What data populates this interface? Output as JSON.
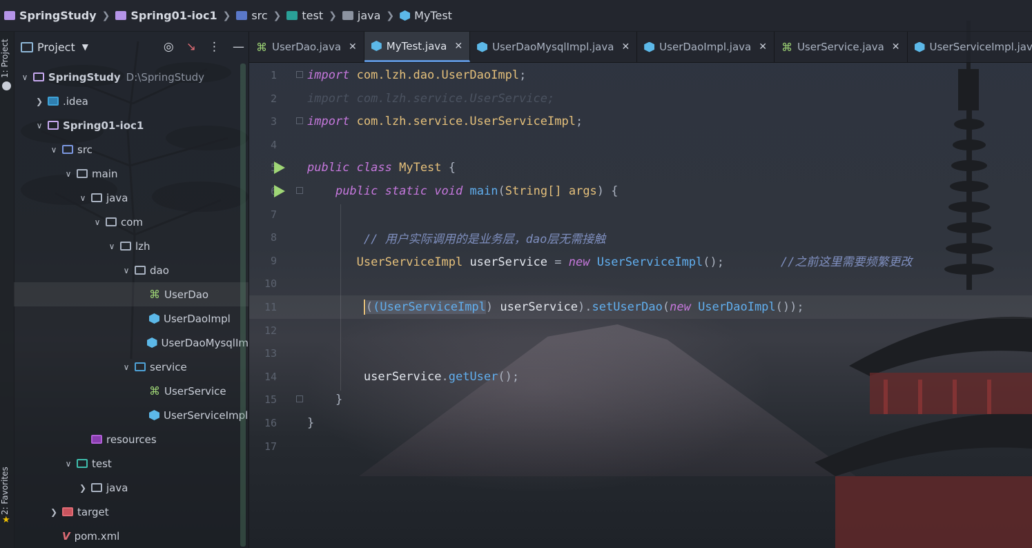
{
  "breadcrumb": [
    "SpringStudy",
    "Spring01-ioc1",
    "src",
    "test",
    "java",
    "MyTest"
  ],
  "toolstrip": {
    "project_label": "1: Project",
    "favorites_label": "2: Favorites"
  },
  "project_panel": {
    "title": "Project",
    "tree": [
      {
        "label": "SpringStudy",
        "hint": "D:\\SpringStudy",
        "depth": 0,
        "icon": "module-folder-icon",
        "expanded": true
      },
      {
        "label": ".idea",
        "depth": 1,
        "icon": "idea-folder-icon",
        "expanded": false
      },
      {
        "label": "Spring01-ioc1",
        "depth": 1,
        "icon": "module-folder-icon",
        "expanded": true
      },
      {
        "label": "src",
        "depth": 2,
        "icon": "source-folder-icon",
        "expanded": true
      },
      {
        "label": "main",
        "depth": 3,
        "icon": "folder-icon",
        "expanded": true
      },
      {
        "label": "java",
        "depth": 4,
        "icon": "folder-icon",
        "expanded": true
      },
      {
        "label": "com",
        "depth": 5,
        "icon": "folder-icon",
        "expanded": true
      },
      {
        "label": "lzh",
        "depth": 6,
        "icon": "folder-icon",
        "expanded": true
      },
      {
        "label": "dao",
        "depth": 7,
        "icon": "folder-icon",
        "expanded": true
      },
      {
        "label": "UserDao",
        "depth": 8,
        "icon": "interface-icon"
      },
      {
        "label": "UserDaoImpl",
        "depth": 8,
        "icon": "class-icon"
      },
      {
        "label": "UserDaoMysqlIm",
        "depth": 8,
        "icon": "class-icon"
      },
      {
        "label": "service",
        "depth": 7,
        "icon": "package-folder-icon",
        "expanded": true
      },
      {
        "label": "UserService",
        "depth": 8,
        "icon": "interface-icon"
      },
      {
        "label": "UserServiceImpl",
        "depth": 8,
        "icon": "class-icon"
      },
      {
        "label": "resources",
        "depth": 4,
        "icon": "resources-folder-icon"
      },
      {
        "label": "test",
        "depth": 3,
        "icon": "test-folder-icon",
        "expanded": true
      },
      {
        "label": "java",
        "depth": 4,
        "icon": "folder-icon",
        "expanded": false
      },
      {
        "label": "target",
        "depth": 2,
        "icon": "target-folder-icon",
        "expanded": false
      },
      {
        "label": "pom.xml",
        "depth": 2,
        "icon": "maven-icon"
      }
    ]
  },
  "tabs": [
    {
      "label": "UserDao.java",
      "icon": "interface-icon",
      "active": false
    },
    {
      "label": "MyTest.java",
      "icon": "class-icon",
      "active": true
    },
    {
      "label": "UserDaoMysqlImpl.java",
      "icon": "class-icon",
      "active": false
    },
    {
      "label": "UserDaoImpl.java",
      "icon": "class-icon",
      "active": false
    },
    {
      "label": "UserService.java",
      "icon": "interface-icon",
      "active": false
    },
    {
      "label": "UserServiceImpl.java",
      "icon": "class-icon",
      "active": false
    }
  ],
  "editor": {
    "line_numbers": [
      "1",
      "2",
      "3",
      "4",
      "5",
      "6",
      "7",
      "8",
      "9",
      "10",
      "11",
      "12",
      "13",
      "14",
      "15",
      "16",
      "17"
    ],
    "lines": {
      "l1_kw": "import",
      "l1_pkg": "com.lzh.dao.UserDaoImpl",
      "l1_end": ";",
      "l2": "import com.lzh.service.UserService;",
      "l3_kw": "import",
      "l3_pkg": "com.lzh.service.UserServiceImpl",
      "l3_end": ";",
      "l5_kw1": "public",
      "l5_kw2": "class",
      "l5_name": "MyTest",
      "l5_end": "{",
      "l6_kw1": "public",
      "l6_kw2": "static",
      "l6_kw3": "void",
      "l6_fn": "main",
      "l6_open": "(",
      "l6_type": "String[]",
      "l6_param": "args",
      "l6_end": ") {",
      "l8_comment": "// 用户实际调用的是业务层，dao层无需接触",
      "l9_type": "UserServiceImpl",
      "l9_var": "userService",
      "l9_eq": "=",
      "l9_new": "new",
      "l9_ctor": "UserServiceImpl",
      "l9_end": "();",
      "l9_comment": "//之前这里需要频繁更改",
      "l11_open": "(",
      "l11_cast": "(UserServiceImpl",
      "l11_close": ")",
      "l11_var": "userService",
      "l11_paren": ").",
      "l11_fn": "setUserDao",
      "l11_p": "(",
      "l11_new": "new",
      "l11_ctor": "UserDaoImpl",
      "l11_end": "());",
      "l14_var": "userService",
      "l14_dot": ".",
      "l14_fn": "getUser",
      "l14_end": "();",
      "l15": "}",
      "l16": "}"
    }
  }
}
